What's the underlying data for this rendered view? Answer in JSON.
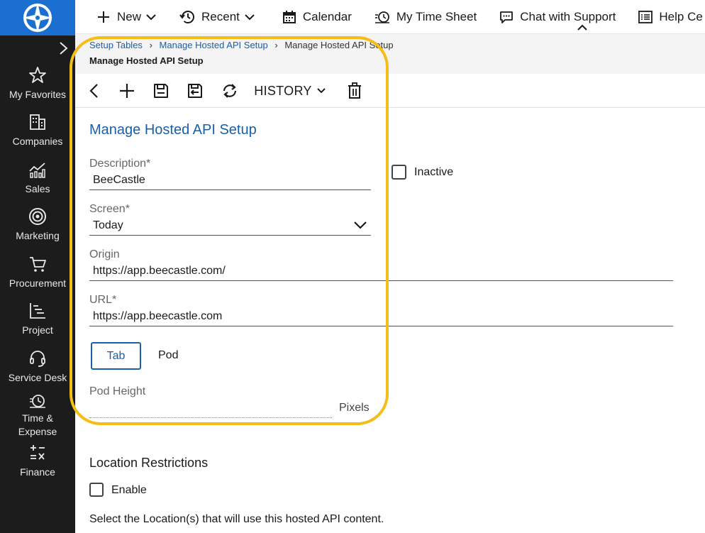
{
  "sidebar": {
    "items": [
      {
        "label": "My Favorites",
        "icon": "star-icon"
      },
      {
        "label": "Companies",
        "icon": "building-icon"
      },
      {
        "label": "Sales",
        "icon": "chart-up-icon"
      },
      {
        "label": "Marketing",
        "icon": "target-icon"
      },
      {
        "label": "Procurement",
        "icon": "cart-icon"
      },
      {
        "label": "Project",
        "icon": "gantt-icon"
      },
      {
        "label": "Service Desk",
        "icon": "headset-icon"
      },
      {
        "label": "Time &",
        "label2": "Expense",
        "icon": "clock-money-icon"
      },
      {
        "label": "Finance",
        "icon": "calculator-icon"
      }
    ]
  },
  "topbar": {
    "new": "New",
    "recent": "Recent",
    "calendar": "Calendar",
    "timesheet": "My Time Sheet",
    "chat": "Chat with Support",
    "help": "Help Ce"
  },
  "breadcrumb": {
    "items": [
      "Setup Tables",
      "Manage Hosted API Setup",
      "Manage Hosted API Setup"
    ],
    "title": "Manage Hosted API Setup"
  },
  "toolbar": {
    "history": "HISTORY"
  },
  "form": {
    "title": "Manage Hosted API Setup",
    "description_label": "Description*",
    "description_value": "BeeCastle",
    "inactive_label": "Inactive",
    "screen_label": "Screen*",
    "screen_value": "Today",
    "origin_label": "Origin",
    "origin_value": "https://app.beecastle.com/",
    "url_label": "URL*",
    "url_value": "https://app.beecastle.com",
    "tab_label": "Tab",
    "pod_label": "Pod",
    "pod_height_label": "Pod Height",
    "pixels_label": "Pixels"
  },
  "location": {
    "title": "Location Restrictions",
    "enable_label": "Enable",
    "description": "Select the Location(s) that will use this hosted API content."
  },
  "colors": {
    "brand_blue": "#1a6fd0",
    "link_blue": "#1a5fa8",
    "highlight": "#f5bd15",
    "sidebar_bg": "#1c1c1c"
  }
}
